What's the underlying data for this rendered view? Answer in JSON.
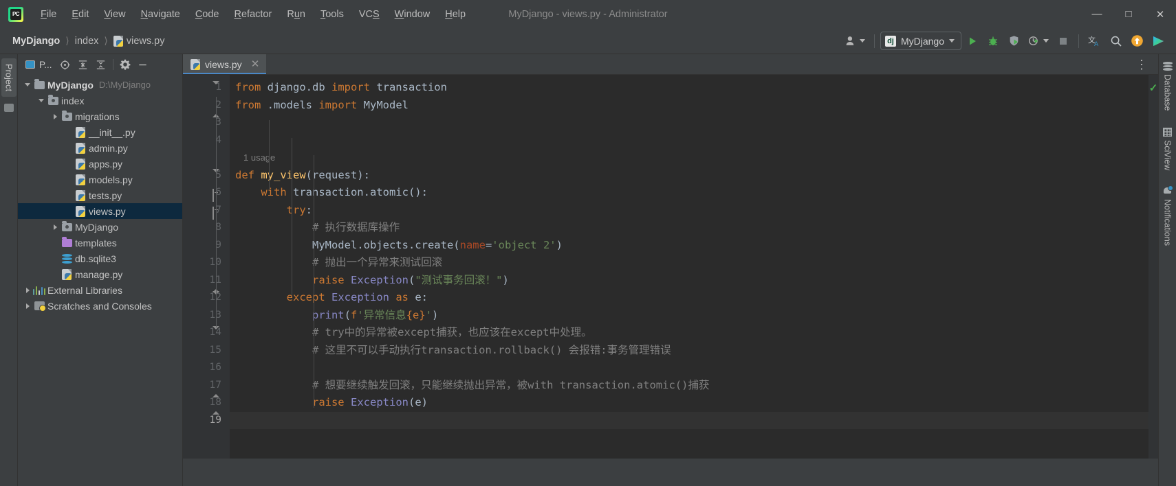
{
  "window": {
    "title": "MyDjango - views.py - Administrator",
    "logo_text": "PC",
    "controls": {
      "minimize": "—",
      "maximize": "□",
      "close": "✕"
    }
  },
  "menubar": {
    "items": [
      {
        "label": "File",
        "mnemonic": "F"
      },
      {
        "label": "Edit",
        "mnemonic": "E"
      },
      {
        "label": "View",
        "mnemonic": "V"
      },
      {
        "label": "Navigate",
        "mnemonic": "N"
      },
      {
        "label": "Code",
        "mnemonic": "C"
      },
      {
        "label": "Refactor",
        "mnemonic": "R"
      },
      {
        "label": "Run",
        "mnemonic": "u"
      },
      {
        "label": "Tools",
        "mnemonic": "T"
      },
      {
        "label": "VCS",
        "mnemonic": "S"
      },
      {
        "label": "Window",
        "mnemonic": "W"
      },
      {
        "label": "Help",
        "mnemonic": "H"
      }
    ]
  },
  "breadcrumb": {
    "items": [
      "MyDjango",
      "index",
      "views.py"
    ],
    "separator": "⟩"
  },
  "toolbar": {
    "account_label": "account-icon",
    "run_config": {
      "label": "MyDjango",
      "badge": "dj"
    },
    "run_label": "Run",
    "debug_label": "Debug",
    "run_coverage_label": "Run with Coverage",
    "profile_label": "Profile",
    "stop_label": "Stop",
    "translate_label": "Translate",
    "search_label": "Search Everywhere",
    "update_label": "Update Project",
    "ide_label": "IDE Actions"
  },
  "project_panel": {
    "title": "P...",
    "buttons": [
      "locate-icon",
      "expand-all-icon",
      "collapse-all-icon",
      "settings-icon",
      "hide-icon"
    ],
    "tree": [
      {
        "label": "MyDjango",
        "path": "D:\\MyDjango",
        "depth": 0,
        "icon": "folder",
        "twisty": "open",
        "bold": true,
        "selected": false
      },
      {
        "label": "index",
        "path": "",
        "depth": 1,
        "icon": "folder-src",
        "twisty": "open",
        "bold": false,
        "selected": false
      },
      {
        "label": "migrations",
        "path": "",
        "depth": 2,
        "icon": "folder-src",
        "twisty": "closed",
        "bold": false,
        "selected": false
      },
      {
        "label": "__init__.py",
        "path": "",
        "depth": 3,
        "icon": "python",
        "twisty": "none",
        "bold": false,
        "selected": false
      },
      {
        "label": "admin.py",
        "path": "",
        "depth": 3,
        "icon": "python",
        "twisty": "none",
        "bold": false,
        "selected": false
      },
      {
        "label": "apps.py",
        "path": "",
        "depth": 3,
        "icon": "python",
        "twisty": "none",
        "bold": false,
        "selected": false
      },
      {
        "label": "models.py",
        "path": "",
        "depth": 3,
        "icon": "python",
        "twisty": "none",
        "bold": false,
        "selected": false
      },
      {
        "label": "tests.py",
        "path": "",
        "depth": 3,
        "icon": "python",
        "twisty": "none",
        "bold": false,
        "selected": false
      },
      {
        "label": "views.py",
        "path": "",
        "depth": 3,
        "icon": "python",
        "twisty": "none",
        "bold": false,
        "selected": true
      },
      {
        "label": "MyDjango",
        "path": "",
        "depth": 2,
        "icon": "folder-src",
        "twisty": "closed",
        "bold": false,
        "selected": false
      },
      {
        "label": "templates",
        "path": "",
        "depth": 2,
        "icon": "folder-purple",
        "twisty": "none",
        "bold": false,
        "selected": false
      },
      {
        "label": "db.sqlite3",
        "path": "",
        "depth": 2,
        "icon": "database",
        "twisty": "none",
        "bold": false,
        "selected": false
      },
      {
        "label": "manage.py",
        "path": "",
        "depth": 2,
        "icon": "python",
        "twisty": "none",
        "bold": false,
        "selected": false
      },
      {
        "label": "External Libraries",
        "path": "",
        "depth": 0,
        "icon": "libraries",
        "twisty": "closed",
        "bold": false,
        "selected": false
      },
      {
        "label": "Scratches and Consoles",
        "path": "",
        "depth": 0,
        "icon": "scratches",
        "twisty": "closed",
        "bold": false,
        "selected": false
      }
    ]
  },
  "left_rail": {
    "project_tab": "Project"
  },
  "right_rail": {
    "items": [
      {
        "label": "Database",
        "icon": "database-icon"
      },
      {
        "label": "SciView",
        "icon": "grid-icon"
      },
      {
        "label": "Notifications",
        "icon": "bell-icon"
      }
    ]
  },
  "editor": {
    "tabs": [
      {
        "label": "views.py",
        "icon": "python-file-icon",
        "active": true,
        "close": "✕"
      }
    ],
    "options_icon": "⋮",
    "inspection_status": "✓",
    "usage_hint": "1 usage",
    "first_line": 1,
    "last_line": 19,
    "caret_line": 19,
    "lines": [
      {
        "n": 1,
        "tokens": [
          {
            "t": "from",
            "c": "k"
          },
          {
            "t": " django.db ",
            "c": "nm"
          },
          {
            "t": "import",
            "c": "k"
          },
          {
            "t": " transaction",
            "c": "nm"
          }
        ],
        "fold": "collapse-down"
      },
      {
        "n": 2,
        "tokens": [
          {
            "t": "from",
            "c": "k"
          },
          {
            "t": " .models ",
            "c": "nm"
          },
          {
            "t": "import",
            "c": "k"
          },
          {
            "t": " MyModel",
            "c": "nm"
          }
        ],
        "fold": "collapse-up"
      },
      {
        "n": 3,
        "tokens": [],
        "fold": ""
      },
      {
        "n": 4,
        "tokens": [],
        "fold": ""
      },
      {
        "n": 5,
        "tokens": [
          {
            "t": "def ",
            "c": "k"
          },
          {
            "t": "my_view",
            "c": "fn"
          },
          {
            "t": "(request):",
            "c": "nm"
          }
        ],
        "fold": "collapse-down"
      },
      {
        "n": 6,
        "tokens": [
          {
            "t": "    ",
            "c": "nm"
          },
          {
            "t": "with",
            "c": "k"
          },
          {
            "t": " transaction.atomic():",
            "c": "nm"
          }
        ],
        "fold": "box"
      },
      {
        "n": 7,
        "tokens": [
          {
            "t": "        ",
            "c": "nm"
          },
          {
            "t": "try",
            "c": "k"
          },
          {
            "t": ":",
            "c": "nm"
          }
        ],
        "fold": "box"
      },
      {
        "n": 8,
        "tokens": [
          {
            "t": "            # 执行数据库操作",
            "c": "cm"
          }
        ],
        "fold": ""
      },
      {
        "n": 9,
        "tokens": [
          {
            "t": "            MyModel.objects.create(",
            "c": "nm"
          },
          {
            "t": "name",
            "c": "pr"
          },
          {
            "t": "=",
            "c": "nm"
          },
          {
            "t": "'object 2'",
            "c": "st"
          },
          {
            "t": ")",
            "c": "nm"
          }
        ],
        "fold": ""
      },
      {
        "n": 10,
        "tokens": [
          {
            "t": "            # 抛出一个异常来测试回滚",
            "c": "cm"
          }
        ],
        "fold": ""
      },
      {
        "n": 11,
        "tokens": [
          {
            "t": "            ",
            "c": "nm"
          },
          {
            "t": "raise",
            "c": "k"
          },
          {
            "t": " ",
            "c": "nm"
          },
          {
            "t": "Exception",
            "c": "cls"
          },
          {
            "t": "(",
            "c": "nm"
          },
          {
            "t": "\"测试事务回滚！\"",
            "c": "st"
          },
          {
            "t": ")",
            "c": "nm"
          }
        ],
        "fold": "collapse-up"
      },
      {
        "n": 12,
        "tokens": [
          {
            "t": "        ",
            "c": "nm"
          },
          {
            "t": "except",
            "c": "k"
          },
          {
            "t": " ",
            "c": "nm"
          },
          {
            "t": "Exception",
            "c": "cls"
          },
          {
            "t": " ",
            "c": "nm"
          },
          {
            "t": "as",
            "c": "k"
          },
          {
            "t": " e:",
            "c": "nm"
          }
        ],
        "fold": "collapse-down"
      },
      {
        "n": 13,
        "tokens": [
          {
            "t": "            ",
            "c": "nm"
          },
          {
            "t": "print",
            "c": "bf"
          },
          {
            "t": "(",
            "c": "nm"
          },
          {
            "t": "f",
            "c": "k"
          },
          {
            "t": "'异常信息",
            "c": "st"
          },
          {
            "t": "{e}",
            "c": "k"
          },
          {
            "t": "'",
            "c": "st"
          },
          {
            "t": ")",
            "c": "nm"
          }
        ],
        "fold": ""
      },
      {
        "n": 14,
        "tokens": [
          {
            "t": "            # try中的异常被except捕获，也应该在except中处理。",
            "c": "cm"
          }
        ],
        "fold": "collapse-down"
      },
      {
        "n": 15,
        "tokens": [
          {
            "t": "            # 这里不可以手动执行transaction.rollback() 会报错:事务管理错误",
            "c": "cm"
          }
        ],
        "fold": ""
      },
      {
        "n": 16,
        "tokens": [],
        "fold": ""
      },
      {
        "n": 17,
        "tokens": [
          {
            "t": "            # 想要继续触发回滚，只能继续抛出异常，被with transaction.atomic()捕获",
            "c": "cm"
          }
        ],
        "fold": "collapse-up"
      },
      {
        "n": 18,
        "tokens": [
          {
            "t": "            ",
            "c": "nm"
          },
          {
            "t": "raise",
            "c": "k"
          },
          {
            "t": " ",
            "c": "nm"
          },
          {
            "t": "Exception",
            "c": "cls"
          },
          {
            "t": "(e)",
            "c": "nm"
          }
        ],
        "fold": "collapse-up"
      },
      {
        "n": 19,
        "tokens": [],
        "fold": ""
      }
    ]
  },
  "colors": {
    "background": "#2b2b2b",
    "chrome": "#3c3f41",
    "gutter": "#313335",
    "selection": "#0d293e",
    "tab_underline": "#4a88c7",
    "keyword": "#cc7832",
    "string": "#6a8759",
    "comment": "#808080",
    "function": "#ffc66d",
    "class": "#8888c6",
    "param": "#aa4926",
    "run_green": "#4caf50",
    "accent_orange": "#f0a732"
  }
}
